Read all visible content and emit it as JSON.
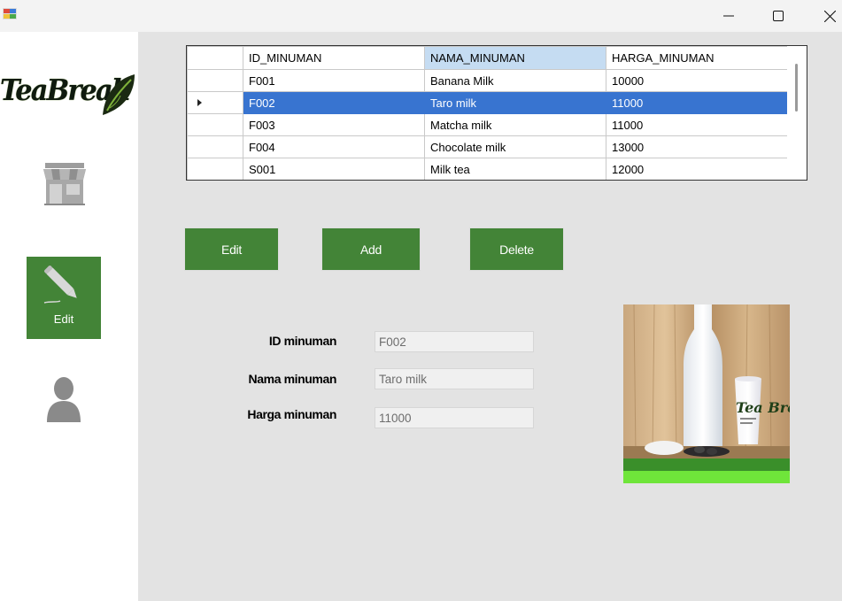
{
  "window": {
    "controls": {
      "minimize": "minimize-icon",
      "maximize": "maximize-icon",
      "close": "close-icon"
    }
  },
  "sidebar": {
    "logo_text": "TeaBreak",
    "nav": [
      {
        "id": "store",
        "icon": "store-icon",
        "label": ""
      },
      {
        "id": "edit",
        "icon": "pencil-icon",
        "label": "Edit",
        "active": true
      },
      {
        "id": "user",
        "icon": "user-icon",
        "label": ""
      }
    ]
  },
  "grid": {
    "columns": [
      "ID_MINUMAN",
      "NAMA_MINUMAN",
      "HARGA_MINUMAN"
    ],
    "selected_column": 1,
    "selected_row": 1,
    "rows": [
      [
        "F001",
        "Banana Milk",
        "10000"
      ],
      [
        "F002",
        "Taro milk",
        "11000"
      ],
      [
        "F003",
        "Matcha milk",
        "11000"
      ],
      [
        "F004",
        "Chocolate milk",
        "13000"
      ],
      [
        "S001",
        "Milk tea",
        "12000"
      ]
    ]
  },
  "buttons": {
    "edit": "Edit",
    "add": "Add",
    "delete": "Delete"
  },
  "form": {
    "id_label": "ID minuman",
    "id_value": "F002",
    "nama_label": "Nama minuman",
    "nama_value": "Taro milk",
    "harga_label": "Harga minuman",
    "harga_value": "11000"
  },
  "product_image": {
    "cup_text": "Tea Brea"
  },
  "colors": {
    "accent_green": "#438437",
    "selection_blue": "#3874d0",
    "header_selected": "#c5dcf2",
    "panel_bg": "#e3e3e3"
  }
}
